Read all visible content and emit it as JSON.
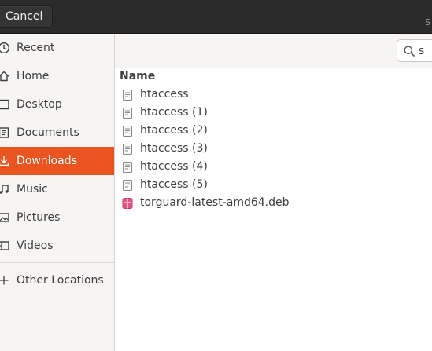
{
  "header": {
    "cancel_label": "Cancel",
    "title_fragment": "S"
  },
  "sidebar": {
    "items": [
      {
        "label": "Recent",
        "icon": "clock-icon"
      },
      {
        "label": "Home",
        "icon": "home-icon"
      },
      {
        "label": "Desktop",
        "icon": "desktop-icon"
      },
      {
        "label": "Documents",
        "icon": "document-icon"
      },
      {
        "label": "Downloads",
        "icon": "download-icon",
        "active": true
      },
      {
        "label": "Music",
        "icon": "music-note-icon"
      },
      {
        "label": "Pictures",
        "icon": "picture-icon"
      },
      {
        "label": "Videos",
        "icon": "film-icon"
      },
      {
        "label": "Other Locations",
        "icon": "plus-icon"
      }
    ]
  },
  "search": {
    "value": "s"
  },
  "columns": {
    "name": "Name"
  },
  "files": [
    {
      "name": "htaccess",
      "type": "text-file-icon"
    },
    {
      "name": "htaccess (1)",
      "type": "text-file-icon"
    },
    {
      "name": "htaccess (2)",
      "type": "text-file-icon"
    },
    {
      "name": "htaccess (3)",
      "type": "text-file-icon"
    },
    {
      "name": "htaccess (4)",
      "type": "text-file-icon"
    },
    {
      "name": "htaccess (5)",
      "type": "text-file-icon"
    },
    {
      "name": "torguard-latest-amd64.deb",
      "type": "package-icon"
    }
  ],
  "colors": {
    "accent": "#e95420",
    "headerbar": "#2b2b2b",
    "sidebar": "#f6f5f4"
  }
}
